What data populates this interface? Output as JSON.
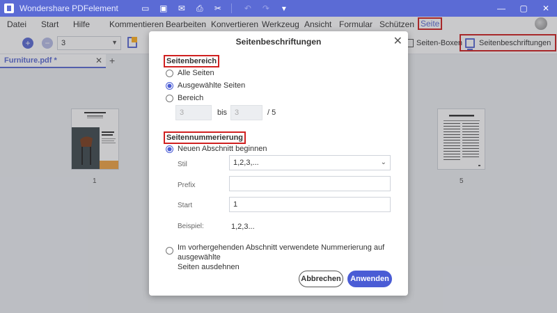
{
  "app": {
    "title": "Wondershare PDFelement",
    "window_controls": [
      "—",
      "▢",
      "✕"
    ]
  },
  "menu": {
    "items": [
      "Datei",
      "Start",
      "Hilfe",
      "Kommentieren",
      "Bearbeiten",
      "Konvertieren",
      "Werkzeug",
      "Ansicht",
      "Formular",
      "Schützen",
      "Seite"
    ],
    "active": "Seite"
  },
  "toolbar": {
    "page_value": "3",
    "seiten_boxen_label": "Seiten-Boxen",
    "seitenbeschriftungen_label": "Seitenbeschriftungen"
  },
  "tabs": {
    "document": "Furniture.pdf *"
  },
  "thumbnails": [
    {
      "label": "1"
    },
    {
      "label": "5"
    }
  ],
  "dialog": {
    "title": "Seitenbeschriftungen",
    "page_range": {
      "heading": "Seitenbereich",
      "options": [
        "Alle Seiten",
        "Ausgewählte Seiten",
        "Bereich"
      ],
      "selected": "Ausgewählte Seiten",
      "from_value": "3",
      "to_label": "bis",
      "to_value": "3",
      "total": "/ 5"
    },
    "numbering": {
      "heading": "Seitennummerierung",
      "new_section_label": "Neuen Abschnitt beginnen",
      "style_label": "Stil",
      "style_value": "1,2,3,...",
      "prefix_label": "Prefix",
      "prefix_value": "",
      "start_label": "Start",
      "start_value": "1",
      "example_label": "Beispiel:",
      "example_value": "1,2,3...",
      "extend_label_line1": "Im vorhergehenden Abschnitt verwendete Nummerierung auf ausgewählte",
      "extend_label_line2": "Seiten ausdehnen"
    },
    "buttons": {
      "cancel": "Abbrechen",
      "apply": "Anwenden"
    }
  },
  "colors": {
    "accent": "#5b6bd5",
    "highlight_border": "#d02020",
    "primary_button": "#4a5cd5"
  }
}
